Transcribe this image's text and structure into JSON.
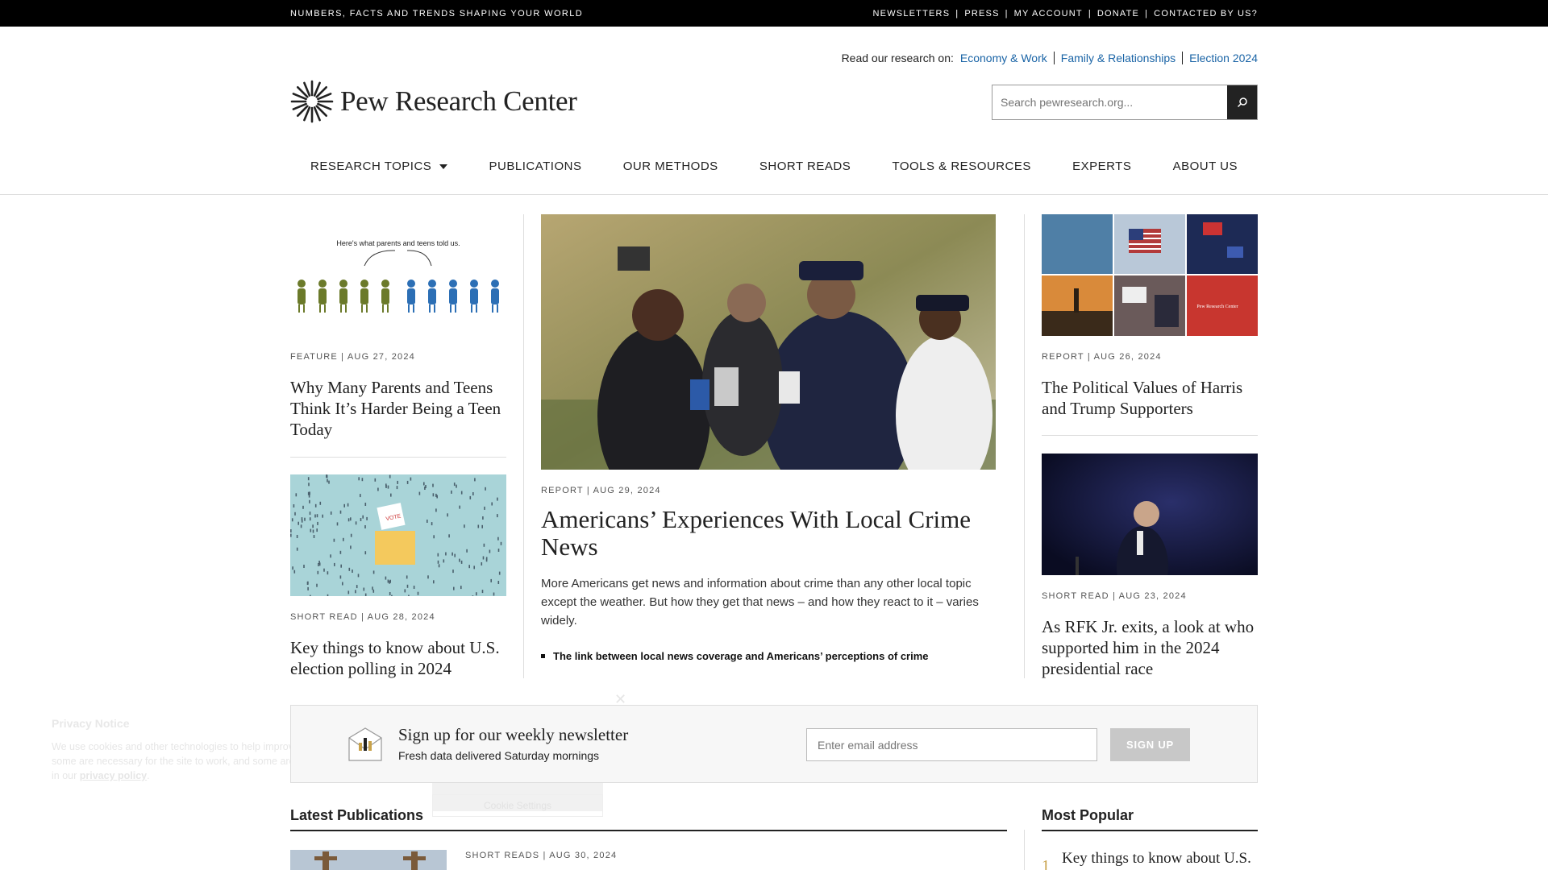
{
  "topbar": {
    "tagline": "NUMBERS, FACTS AND TRENDS SHAPING YOUR WORLD",
    "links": [
      "NEWSLETTERS",
      "PRESS",
      "MY ACCOUNT",
      "DONATE",
      "CONTACTED BY US?"
    ]
  },
  "header": {
    "read_label": "Read our research on:",
    "topics": [
      "Economy & Work",
      "Family & Relationships",
      "Election 2024"
    ],
    "logo_text": "Pew Research Center",
    "search_placeholder": "Search pewresearch.org..."
  },
  "nav": [
    "RESEARCH TOPICS",
    "PUBLICATIONS",
    "OUR METHODS",
    "SHORT READS",
    "TOOLS & RESOURCES",
    "EXPERTS",
    "ABOUT US"
  ],
  "left": [
    {
      "meta": "FEATURE | AUG 27, 2024",
      "title": "Why Many Parents and Teens Think It’s Harder Being a Teen Today",
      "image_caption": "Here's what parents and teens told us."
    },
    {
      "meta": "SHORT READ | AUG 28, 2024",
      "title": "Key things to know about U.S. election polling in 2024",
      "ballot_text": "VOTE"
    }
  ],
  "main": {
    "meta": "REPORT | AUG 29, 2024",
    "title": "Americans’ Experiences With Local Crime News",
    "description": "More Americans get news and information about crime than any other local topic except the weather. But how they get that news – and how they react to it – varies widely.",
    "bullet": "The link between local news coverage and Americans’ perceptions of crime"
  },
  "right": [
    {
      "meta": "REPORT | AUG 26, 2024",
      "title": "The Political Values of Harris and Trump Supporters",
      "tile_text": "Pew Research Center"
    },
    {
      "meta": "SHORT READ | AUG 23, 2024",
      "title": "As RFK Jr. exits, a look at who supported him in the 2024 presidential race"
    }
  ],
  "newsletter": {
    "title": "Sign up for our weekly newsletter",
    "subtitle": "Fresh data delivered Saturday mornings",
    "email_placeholder": "Enter email address",
    "button": "SIGN UP"
  },
  "privacy": {
    "title": "Privacy Notice",
    "text_before": "We use cookies and other technologies to help improve your experience; some are necessary for the site to work, and some are optional. Learn more in our ",
    "link": "privacy policy",
    "text_after": ".",
    "settings_button": "Cookie Settings"
  },
  "sections": {
    "latest": "Latest Publications",
    "popular": "Most Popular",
    "latest_meta": "SHORT READS | AUG 30, 2024",
    "popular_num": "1",
    "popular_first": "Key things to know about U.S."
  },
  "colors": {
    "accent_link": "#1a64a6",
    "topbar": "#000000",
    "gold": "#c8a24a"
  }
}
